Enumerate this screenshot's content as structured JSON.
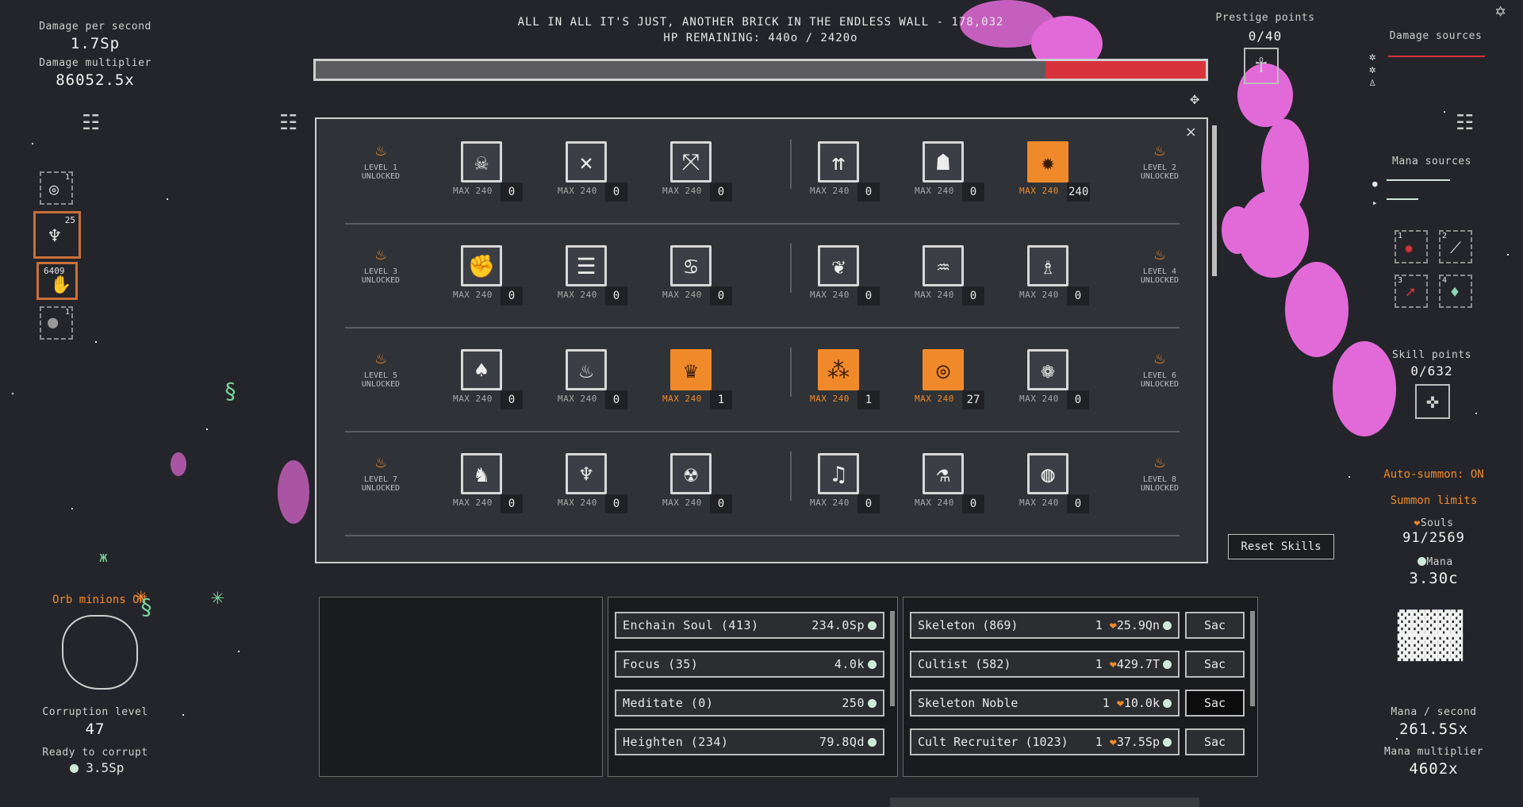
{
  "colors": {
    "accent": "#f08a2a",
    "hp_fill": "#d8323c",
    "pink_fx": "#e26ad8",
    "panel_bg": "#2f3237"
  },
  "left_stats": {
    "dps_label": "Damage per second",
    "dps_value": "1.7Sp",
    "mult_label": "Damage multiplier",
    "mult_value": "86052.5x"
  },
  "boss": {
    "title": "ALL IN ALL IT'S JUST, ANOTHER BRICK IN THE ENDLESS WALL - 178,032",
    "hp_text": "HP REMAINING: 440o / 2420o",
    "hp_fraction": 0.18
  },
  "prestige": {
    "label": "Prestige points",
    "value": "0/40"
  },
  "damage_sources": {
    "label": "Damage sources"
  },
  "mana_sources": {
    "label": "Mana sources"
  },
  "skill_points": {
    "label": "Skill points",
    "value": "0/632"
  },
  "left_slots": [
    {
      "icon": "target-icon",
      "count": "1"
    },
    {
      "icon": "dead-tree-icon",
      "count": "25"
    },
    {
      "icon": "orb-hand-icon",
      "count": "6409"
    },
    {
      "icon": "moon-icon",
      "count": "1"
    }
  ],
  "right_slots": [
    {
      "num": "1",
      "icon": "gear-icon"
    },
    {
      "num": "2",
      "icon": "feather-icon"
    },
    {
      "num": "3",
      "icon": "arrow-icon"
    },
    {
      "num": "4",
      "icon": "drop-icon"
    }
  ],
  "skill_tree": {
    "close_label": "×",
    "rows": [
      {
        "left_level": "LEVEL 1 UNLOCKED",
        "right_level": "LEVEL 2 UNLOCKED",
        "skills": [
          {
            "icon": "skull-icon",
            "glyph": "☠",
            "max": "MAX 240",
            "count": "0",
            "active": false
          },
          {
            "icon": "crossed-arrows-icon",
            "glyph": "✕",
            "max": "MAX 240",
            "count": "0",
            "active": false
          },
          {
            "icon": "converge-icon",
            "glyph": "⤧",
            "max": "MAX 240",
            "count": "0",
            "active": false
          },
          {
            "icon": "arrow-volley-icon",
            "glyph": "⇈",
            "max": "MAX 240",
            "count": "0",
            "active": false
          },
          {
            "icon": "hooded-face-icon",
            "glyph": "☗",
            "max": "MAX 240",
            "count": "0",
            "active": false
          },
          {
            "icon": "sun-gear-icon",
            "glyph": "✹",
            "max": "MAX 240",
            "count": "240",
            "active": true
          }
        ]
      },
      {
        "left_level": "LEVEL 3 UNLOCKED",
        "right_level": "LEVEL 4 UNLOCKED",
        "skills": [
          {
            "icon": "fist-icon",
            "glyph": "✊",
            "max": "MAX 240",
            "count": "0",
            "active": false
          },
          {
            "icon": "scroll-icon",
            "glyph": "☰",
            "max": "MAX 240",
            "count": "0",
            "active": false
          },
          {
            "icon": "vortex-icon",
            "glyph": "♋",
            "max": "MAX 240",
            "count": "0",
            "active": false
          },
          {
            "icon": "leaf-orb-icon",
            "glyph": "❦",
            "max": "MAX 240",
            "count": "0",
            "active": false
          },
          {
            "icon": "brain-icon",
            "glyph": "♒",
            "max": "MAX 240",
            "count": "0",
            "active": false
          },
          {
            "icon": "priest-icon",
            "glyph": "♗",
            "max": "MAX 240",
            "count": "0",
            "active": false
          }
        ]
      },
      {
        "left_level": "LEVEL 5 UNLOCKED",
        "right_level": "LEVEL 6 UNLOCKED",
        "skills": [
          {
            "icon": "drop-dagger-icon",
            "glyph": "♠",
            "max": "MAX 240",
            "count": "0",
            "active": false
          },
          {
            "icon": "flames-icon",
            "glyph": "♨",
            "max": "MAX 240",
            "count": "0",
            "active": false
          },
          {
            "icon": "crowned-skull-icon",
            "glyph": "♛",
            "max": "MAX 240",
            "count": "1",
            "active": true
          },
          {
            "icon": "triple-drop-icon",
            "glyph": "⁂",
            "max": "MAX 240",
            "count": "1",
            "active": true
          },
          {
            "icon": "bullseye-icon",
            "glyph": "◎",
            "max": "MAX 240",
            "count": "27",
            "active": true
          },
          {
            "icon": "tangle-icon",
            "glyph": "❁",
            "max": "MAX 240",
            "count": "0",
            "active": false
          }
        ]
      },
      {
        "left_level": "LEVEL 7 UNLOCKED",
        "right_level": "LEVEL 8 UNLOCKED",
        "skills": [
          {
            "icon": "camel-icon",
            "glyph": "♞",
            "max": "MAX 240",
            "count": "0",
            "active": false
          },
          {
            "icon": "eagle-icon",
            "glyph": "♆",
            "max": "MAX 240",
            "count": "0",
            "active": false
          },
          {
            "icon": "screaming-skull-icon",
            "glyph": "☢",
            "max": "MAX 240",
            "count": "0",
            "active": false
          },
          {
            "icon": "music-notes-icon",
            "glyph": "♫",
            "max": "MAX 240",
            "count": "0",
            "active": false
          },
          {
            "icon": "mortar-icon",
            "glyph": "⚗",
            "max": "MAX 240",
            "count": "0",
            "active": false
          },
          {
            "icon": "globe-icon",
            "glyph": "◍",
            "max": "MAX 240",
            "count": "0",
            "active": false
          }
        ]
      }
    ]
  },
  "spells": [
    {
      "label": "Enchain Soul (413)",
      "cost": "234.0Sp"
    },
    {
      "label": "Focus (35)",
      "cost": "4.0k"
    },
    {
      "label": "Meditate (0)",
      "cost": "250"
    },
    {
      "label": "Heighten (234)",
      "cost": "79.8Qd"
    }
  ],
  "minions": [
    {
      "label": "Skeleton (869)",
      "qty": "1",
      "cost": "25.9Qn",
      "sac": "Sac"
    },
    {
      "label": "Cultist (582)",
      "qty": "1",
      "cost": "429.7T",
      "sac": "Sac"
    },
    {
      "label": "Skeleton Noble",
      "qty": "1",
      "cost": "10.0k",
      "sac": "Sac"
    },
    {
      "label": "Cult Recruiter (1023)",
      "qty": "1",
      "cost": "37.5Sp",
      "sac": "Sac"
    }
  ],
  "right_panel": {
    "reset_skills": "Reset Skills",
    "auto_summon": "Auto-summon: ON",
    "summon_limits": "Summon limits",
    "souls_label": "Souls",
    "souls_value": "91/2569",
    "mana_label": "Mana",
    "mana_value": "3.30c",
    "mana_sec_label": "Mana / second",
    "mana_sec_value": "261.5Sx",
    "mana_mult_label": "Mana multiplier",
    "mana_mult_value": "4602x"
  },
  "bottom_left": {
    "orb_minions": "Orb minions ON",
    "corruption_label": "Corruption level",
    "corruption_value": "47",
    "ready_label": "Ready to corrupt",
    "ready_value": "3.5Sp"
  }
}
